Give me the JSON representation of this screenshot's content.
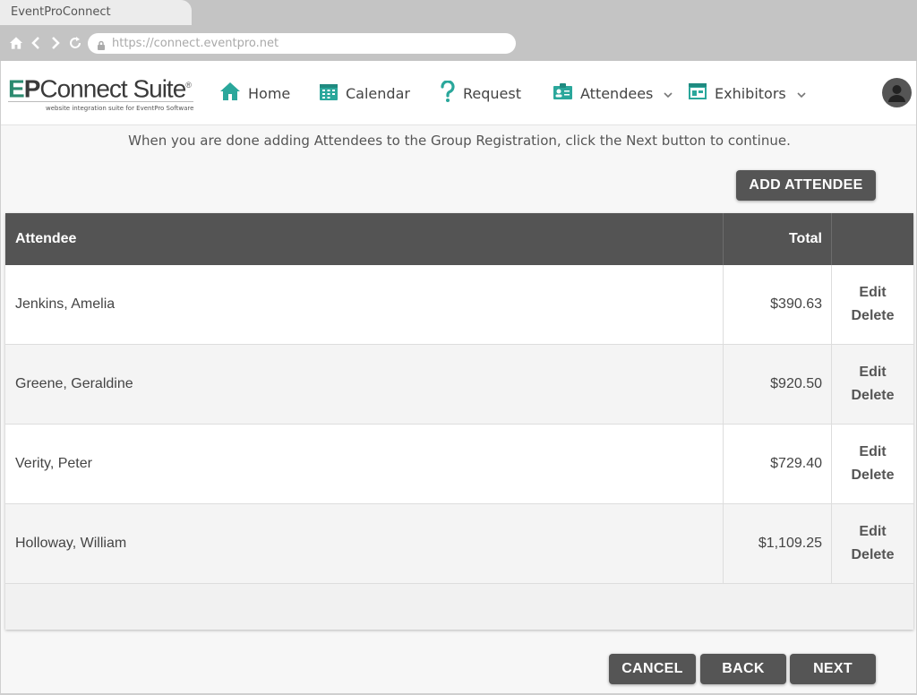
{
  "browser": {
    "tab_title": "EventProConnect",
    "url": "https://connect.eventpro.net"
  },
  "logo": {
    "brand_e": "E",
    "brand_p": "P",
    "brand_rest": "Connect Suite",
    "registered": "®",
    "tagline": "website integration suite for EventPro Software"
  },
  "nav": {
    "home": "Home",
    "calendar": "Calendar",
    "request": "Request",
    "attendees": "Attendees",
    "exhibitors": "Exhibitors"
  },
  "instructions": "When you are done adding Attendees to the Group Registration, click the Next button to continue.",
  "add_attendee_label": "ADD ATTENDEE",
  "table": {
    "headers": {
      "attendee": "Attendee",
      "total": "Total",
      "actions": ""
    },
    "rows": [
      {
        "name": "Jenkins, Amelia",
        "total": "$390.63",
        "edit": "Edit",
        "delete": "Delete"
      },
      {
        "name": "Greene, Geraldine",
        "total": "$920.50",
        "edit": "Edit",
        "delete": "Delete"
      },
      {
        "name": "Verity, Peter",
        "total": "$729.40",
        "edit": "Edit",
        "delete": "Delete"
      },
      {
        "name": "Holloway, William",
        "total": "$1,109.25",
        "edit": "Edit",
        "delete": "Delete"
      }
    ]
  },
  "footer_buttons": {
    "cancel": "CANCEL",
    "back": "BACK",
    "next": "NEXT"
  },
  "colors": {
    "accent_teal": "#2aa79b",
    "header_dark": "#545454",
    "button_dark": "#555555"
  },
  "icons": [
    "home-icon",
    "back-icon",
    "forward-icon",
    "reload-icon",
    "lock-icon",
    "calendar-icon",
    "question-icon",
    "attendees-icon",
    "exhibitors-icon",
    "chevron-down-icon",
    "user-avatar-icon"
  ]
}
